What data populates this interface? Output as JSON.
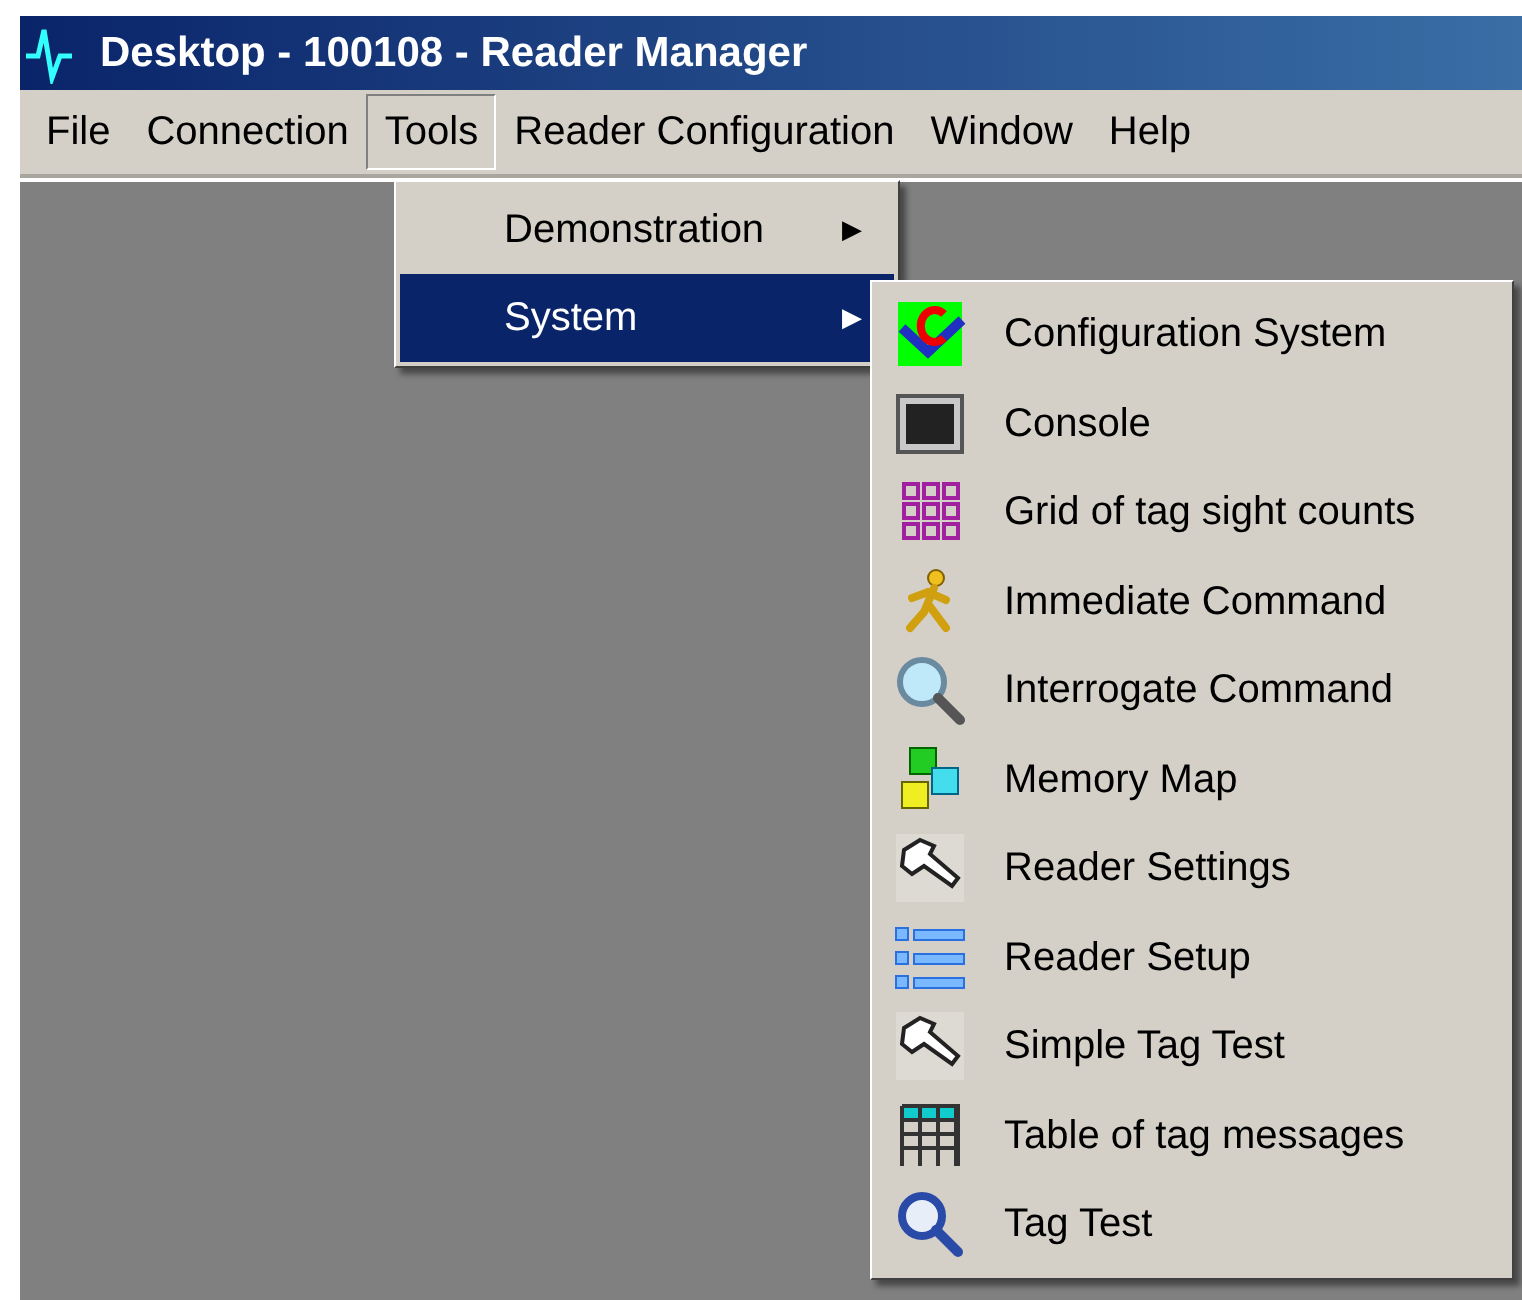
{
  "window": {
    "title": "Desktop - 100108 - Reader Manager"
  },
  "menu_bar": [
    {
      "label": "File",
      "selected": false
    },
    {
      "label": "Connection",
      "selected": false
    },
    {
      "label": "Tools",
      "selected": true
    },
    {
      "label": "Reader Configuration",
      "selected": false
    },
    {
      "label": "Window",
      "selected": false
    },
    {
      "label": "Help",
      "selected": false
    }
  ],
  "tools_menu": [
    {
      "label": "Demonstration",
      "selected": false,
      "submenu_arrow": "▶"
    },
    {
      "label": "System",
      "selected": true,
      "submenu_arrow": "▶"
    }
  ],
  "system_submenu": [
    {
      "label": "Configuration System"
    },
    {
      "label": "Console"
    },
    {
      "label": "Grid of tag sight counts"
    },
    {
      "label": "Immediate Command"
    },
    {
      "label": "Interrogate Command"
    },
    {
      "label": "Memory Map"
    },
    {
      "label": "Reader Settings"
    },
    {
      "label": "Reader Setup"
    },
    {
      "label": "Simple Tag Test"
    },
    {
      "label": "Table of tag messages"
    },
    {
      "label": "Tag Test"
    }
  ]
}
